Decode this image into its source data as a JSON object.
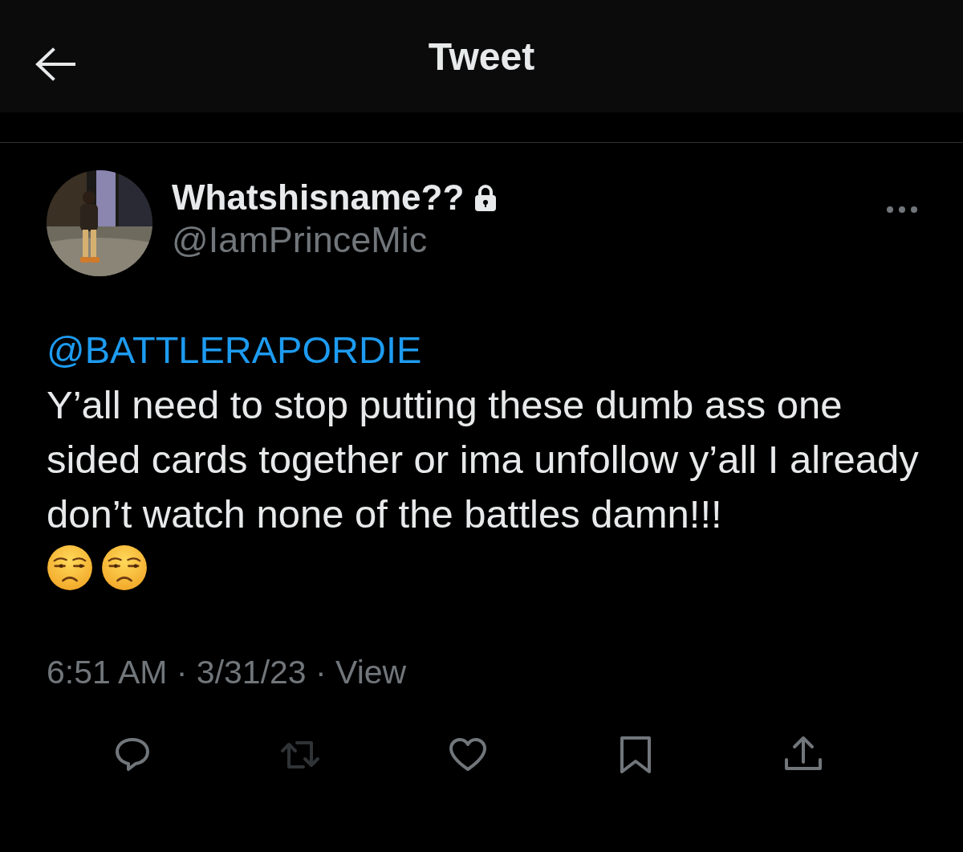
{
  "header": {
    "title": "Tweet"
  },
  "tweet": {
    "author": {
      "name": "Whatshisname??",
      "protected": true,
      "handle": "@IamPrinceMic"
    },
    "mention": "@BATTLERAPORDIE",
    "body": "Y’all need to stop putting these dumb ass one sided cards together or ima unfollow y’all I already don’t watch none of the battles damn!!!",
    "emojis": [
      {
        "kind": "unamused"
      },
      {
        "kind": "unamused"
      }
    ],
    "timestamp": "6:51 AM · 3/31/23 · View"
  },
  "actions": [
    {
      "kind": "reply",
      "disabled": false
    },
    {
      "kind": "retweet",
      "disabled": true
    },
    {
      "kind": "like",
      "disabled": false
    },
    {
      "kind": "bookmark",
      "disabled": false
    },
    {
      "kind": "share",
      "disabled": false
    }
  ]
}
